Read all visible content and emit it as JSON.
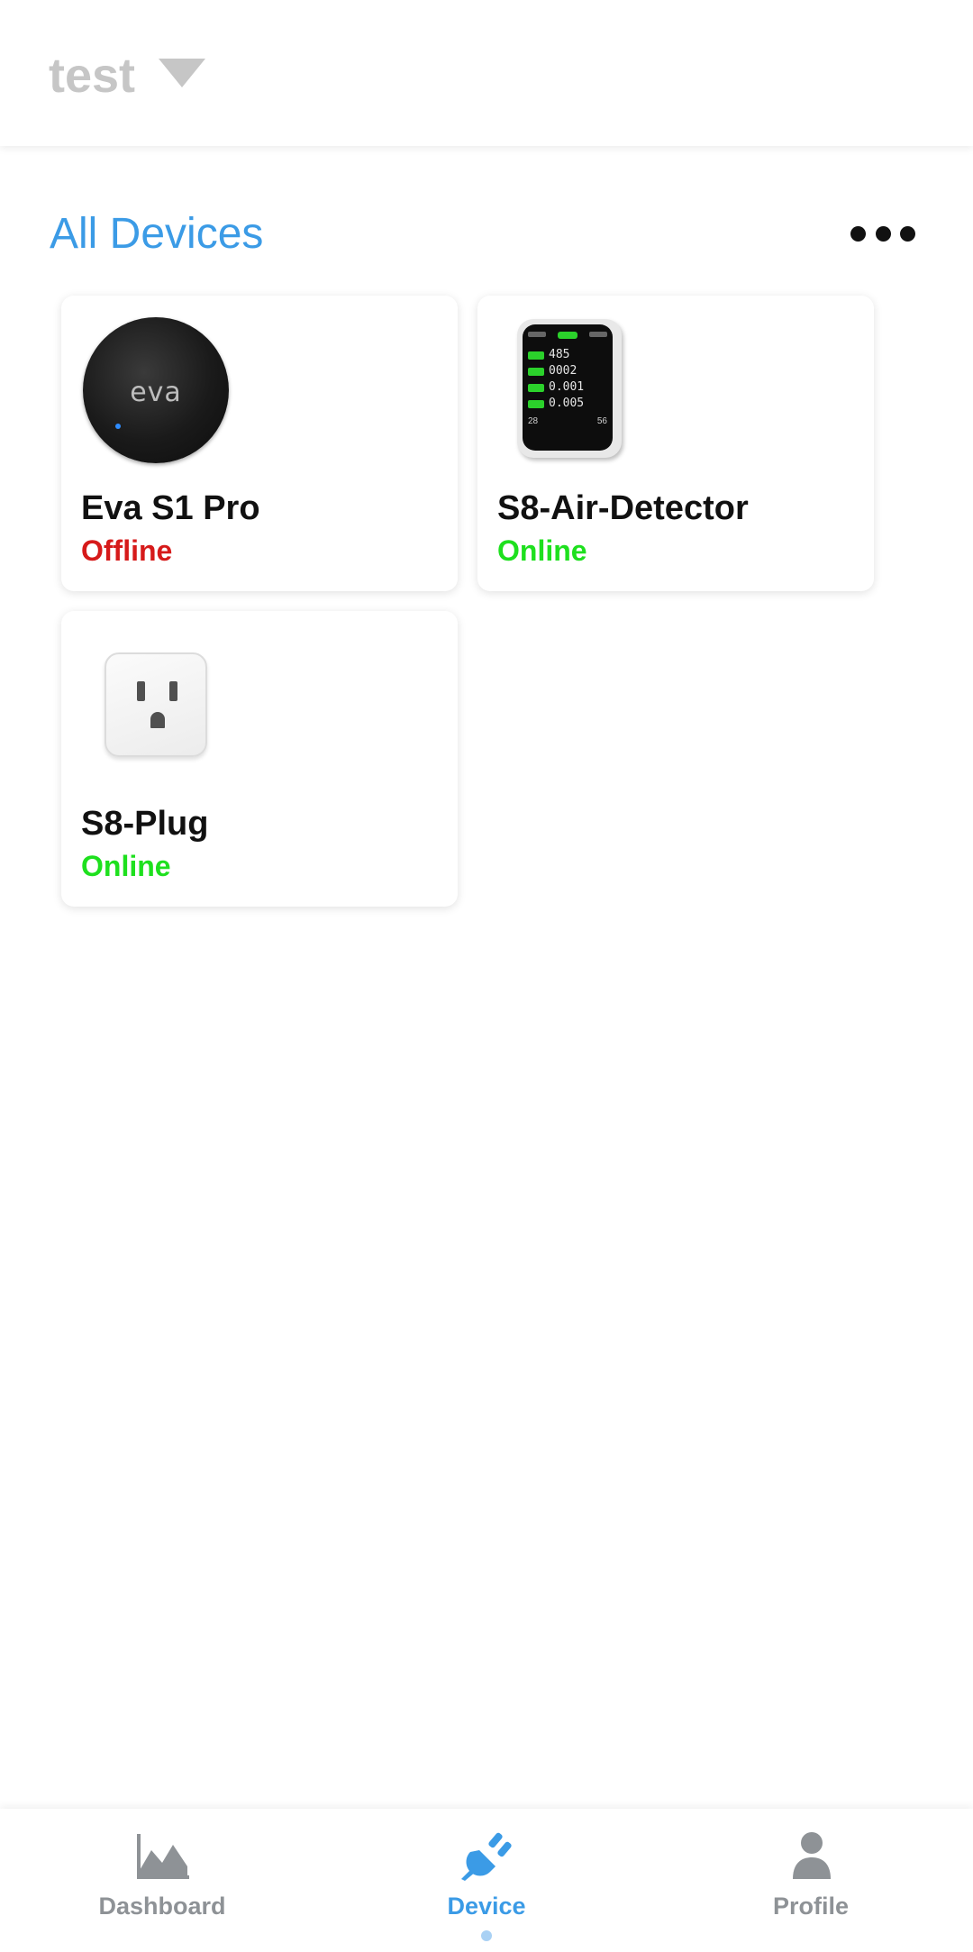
{
  "header": {
    "home_name": "test",
    "dropdown_icon": "caret-down-icon"
  },
  "section": {
    "title": "All Devices",
    "more_icon": "more-horizontal-icon"
  },
  "devices": [
    {
      "name": "Eva S1 Pro",
      "status": "Offline",
      "image_icon": "eva-puck-image",
      "logo_text": "eva"
    },
    {
      "name": "S8-Air-Detector",
      "status": "Online",
      "image_icon": "air-detector-image",
      "screen_values": [
        "485",
        "0002",
        "0.001",
        "0.005"
      ],
      "screen_footer": [
        "28",
        "56"
      ]
    },
    {
      "name": "S8-Plug",
      "status": "Online",
      "image_icon": "plug-image"
    }
  ],
  "nav": {
    "items": [
      {
        "label": "Dashboard",
        "icon": "area-chart-icon",
        "active": false
      },
      {
        "label": "Device",
        "icon": "plug-icon",
        "active": true
      },
      {
        "label": "Profile",
        "icon": "person-icon",
        "active": false
      }
    ]
  },
  "colors": {
    "accent": "#3b9be6",
    "offline": "#d61a1a",
    "online": "#1ee01e",
    "inactive_nav": "#8e9296",
    "header_text": "#c6c6c6"
  }
}
